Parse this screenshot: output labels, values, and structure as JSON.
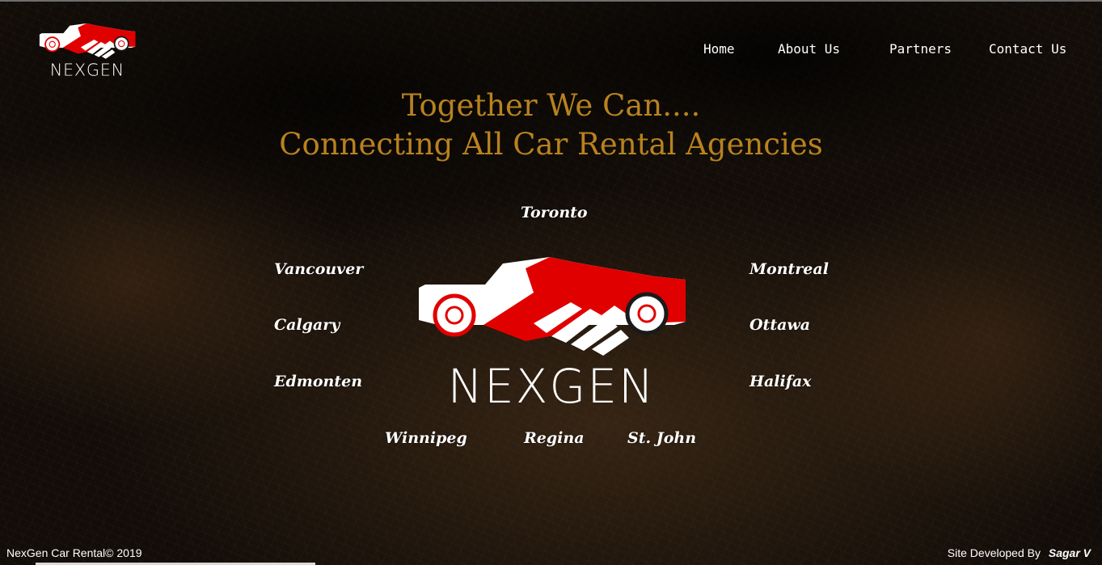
{
  "brand": {
    "logo_text": "NEXGEN",
    "accent": "#e10000"
  },
  "nav": [
    {
      "label": "Home"
    },
    {
      "label": "About Us"
    },
    {
      "label": "Partners"
    },
    {
      "label": "Contact Us"
    }
  ],
  "hero": {
    "line1": "Together We Can....",
    "line2": "Connecting All Car Rental Agencies",
    "heading_color": "#b8821f"
  },
  "cities": {
    "toronto": "Toronto",
    "vancouver": "Vancouver",
    "montreal": "Montreal",
    "calgary": "Calgary",
    "ottawa": "Ottawa",
    "edmonten": "Edmonten",
    "halifax": "Halifax",
    "winnipeg": "Winnipeg",
    "regina": "Regina",
    "stjohn": "St. John"
  },
  "footer": {
    "copyright": "NexGen Car Rental© 2019",
    "credit_label": "Site Developed By",
    "developer": "Sagar V"
  }
}
